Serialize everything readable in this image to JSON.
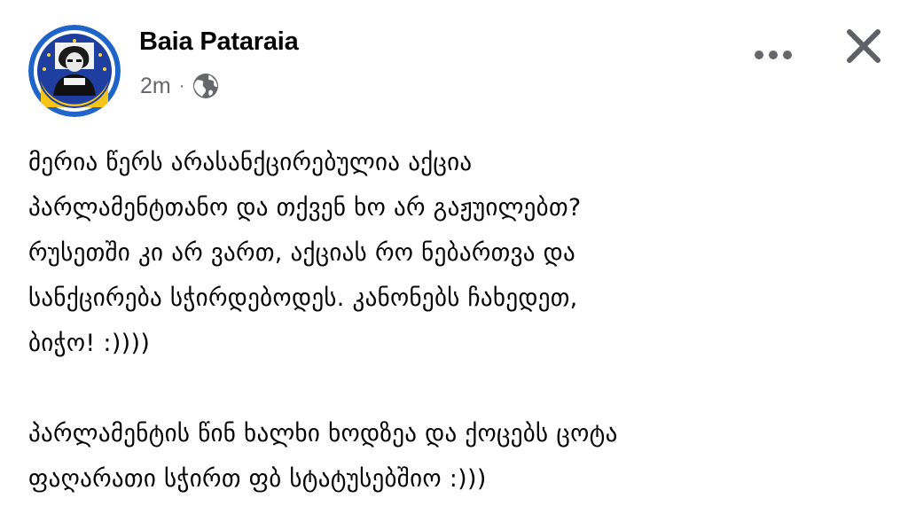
{
  "post": {
    "author": "Baia Pataraia",
    "timestamp": "2m",
    "separator": "·",
    "audience_icon": "globe-icon",
    "more_icon": "more-options-icon",
    "close_icon": "close-icon",
    "avatar_colors": {
      "ring_outer": "#1f64c8",
      "ring_inner": "#ffffff",
      "eu_blue": "#1e3fa0",
      "yellow": "#f5c518",
      "star": "#f5d442"
    },
    "paragraphs": [
      "მერია წერს არასანქცირებულია აქცია\nპარლამენტთანო და თქვენ ხო არ გაჟუილებთ?\nრუსეთში კი არ ვართ, აქციას რო ნებართვა და\nსანქცირება სჭირდებოდეს. კანონებს ჩახედეთ,\nბიჭო! :))))",
      "პარლამენტის წინ ხალხი ხოდზეა და ქოცებს ცოტა\nფაღარათი სჭირთ ფბ სტატუსებშიო :)))"
    ]
  }
}
